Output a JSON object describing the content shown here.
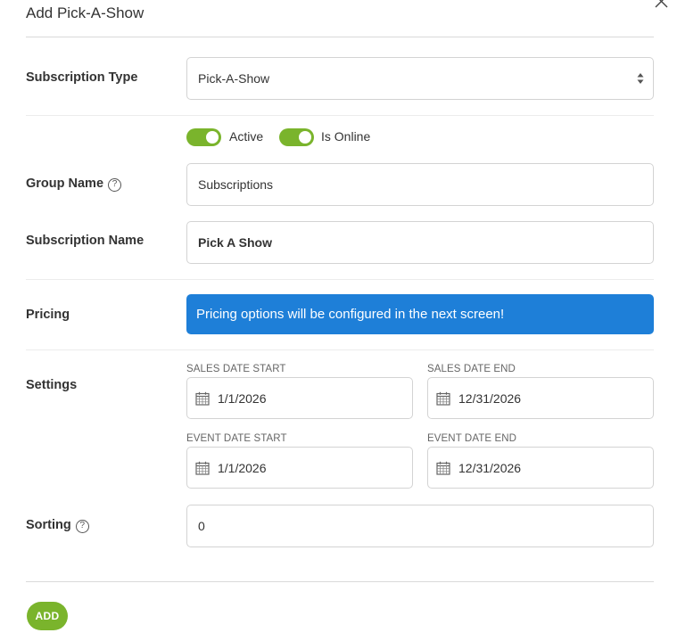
{
  "dialog": {
    "title": "Add Pick-A-Show",
    "close_icon": "close-icon"
  },
  "subscription_type": {
    "label": "Subscription Type",
    "selected": "Pick-A-Show"
  },
  "toggles": {
    "active_label": "Active",
    "active_on": true,
    "online_label": "Is Online",
    "online_on": true
  },
  "group_name": {
    "label": "Group Name",
    "help_icon": "help-icon",
    "value": "Subscriptions"
  },
  "subscription_name": {
    "label": "Subscription Name",
    "value": "Pick A Show"
  },
  "pricing": {
    "label": "Pricing",
    "message": "Pricing options will be configured in the next screen!"
  },
  "settings": {
    "label": "Settings",
    "sales_start_label": "SALES DATE START",
    "sales_start": "1/1/2026",
    "sales_end_label": "SALES DATE END",
    "sales_end": "12/31/2026",
    "event_start_label": "EVENT DATE START",
    "event_start": "1/1/2026",
    "event_end_label": "EVENT DATE END",
    "event_end": "12/31/2026",
    "calendar_icon": "calendar-icon"
  },
  "sorting": {
    "label": "Sorting",
    "help_icon": "help-icon",
    "value": "0"
  },
  "footer": {
    "add_label": "ADD"
  },
  "colors": {
    "accent_green": "#7ab42c",
    "banner_blue": "#1e7fd8"
  }
}
